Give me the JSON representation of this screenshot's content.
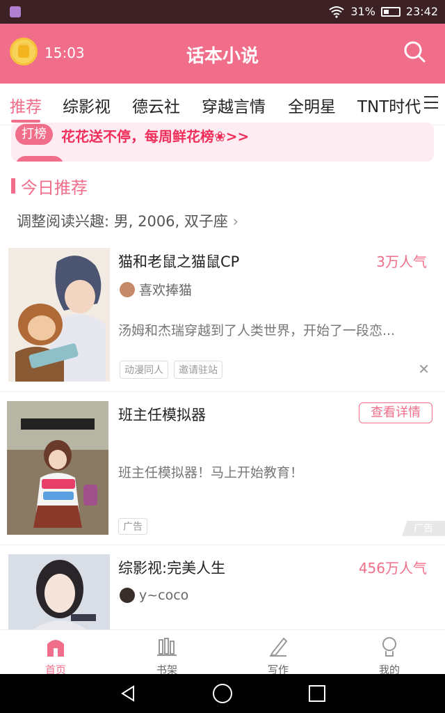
{
  "status_bar": {
    "signal": "31%",
    "time": "23:42"
  },
  "header": {
    "time": "15:03",
    "title": "话本小说"
  },
  "tabs": [
    {
      "label": "推荐",
      "active": true
    },
    {
      "label": "综影视"
    },
    {
      "label": "德云社"
    },
    {
      "label": "穿越言情"
    },
    {
      "label": "全明星"
    },
    {
      "label": "TNT时代"
    }
  ],
  "banner": {
    "tag": "打榜",
    "text": "花花送不停，每周鲜花榜❀>>"
  },
  "section": {
    "title": "今日推荐",
    "prefs": "调整阅读兴趣: 男, 2006, 双子座"
  },
  "cards": [
    {
      "title": "猫和老鼠之猫鼠CP",
      "popularity": "3万人气",
      "author": "喜欢捧猫",
      "description": "汤姆和杰瑞穿越到了人类世界，开始了一段恋...",
      "tags": [
        "动漫同人",
        "邀请驻站"
      ]
    },
    {
      "title": "班主任模拟器",
      "button": "查看详情",
      "description": "班主任模拟器！马上开始教育！",
      "ad_label": "广告",
      "ad_corner": "广告"
    },
    {
      "title": "综影视:完美人生",
      "popularity": "456万人气",
      "author": "y~coco"
    }
  ],
  "bottom_nav": [
    {
      "label": "首页",
      "active": true
    },
    {
      "label": "书架"
    },
    {
      "label": "写作"
    },
    {
      "label": "我的"
    }
  ],
  "colors": {
    "accent": "#f06e8a",
    "banner_text": "#ef2e5b"
  }
}
